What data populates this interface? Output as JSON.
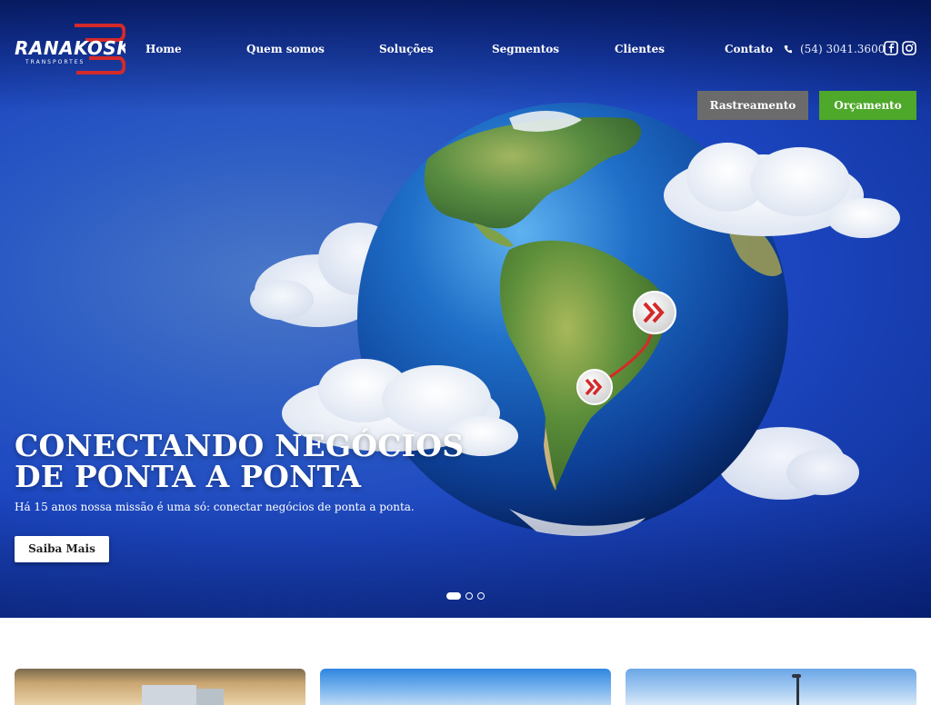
{
  "brand": {
    "name": "RANAKOSKI",
    "tagline": "TRANSPORTES"
  },
  "nav": {
    "items": [
      {
        "label": "Home"
      },
      {
        "label": "Quem somos"
      },
      {
        "label": "Soluções"
      },
      {
        "label": "Segmentos"
      },
      {
        "label": "Clientes"
      },
      {
        "label": "Contato"
      }
    ],
    "phone": "(54) 3041.3600",
    "social": [
      "facebook-icon",
      "instagram-icon"
    ]
  },
  "actions": {
    "tracking_label": "Rastreamento",
    "quote_label": "Orçamento"
  },
  "hero": {
    "headline_line1": "CONECTANDO NEGÓCIOS",
    "headline_line2": "DE PONTA A PONTA",
    "subtitle": "Há 15 anos nossa missão é uma só: conectar negócios de ponta a ponta.",
    "cta_label": "Saiba Mais",
    "slides_total": 3,
    "active_slide": 1
  },
  "colors": {
    "brand_red": "#d42a2a",
    "quote_green": "#4ea82a",
    "tracking_gray": "#6b6b6b",
    "hero_blue": "#1c46c0"
  }
}
